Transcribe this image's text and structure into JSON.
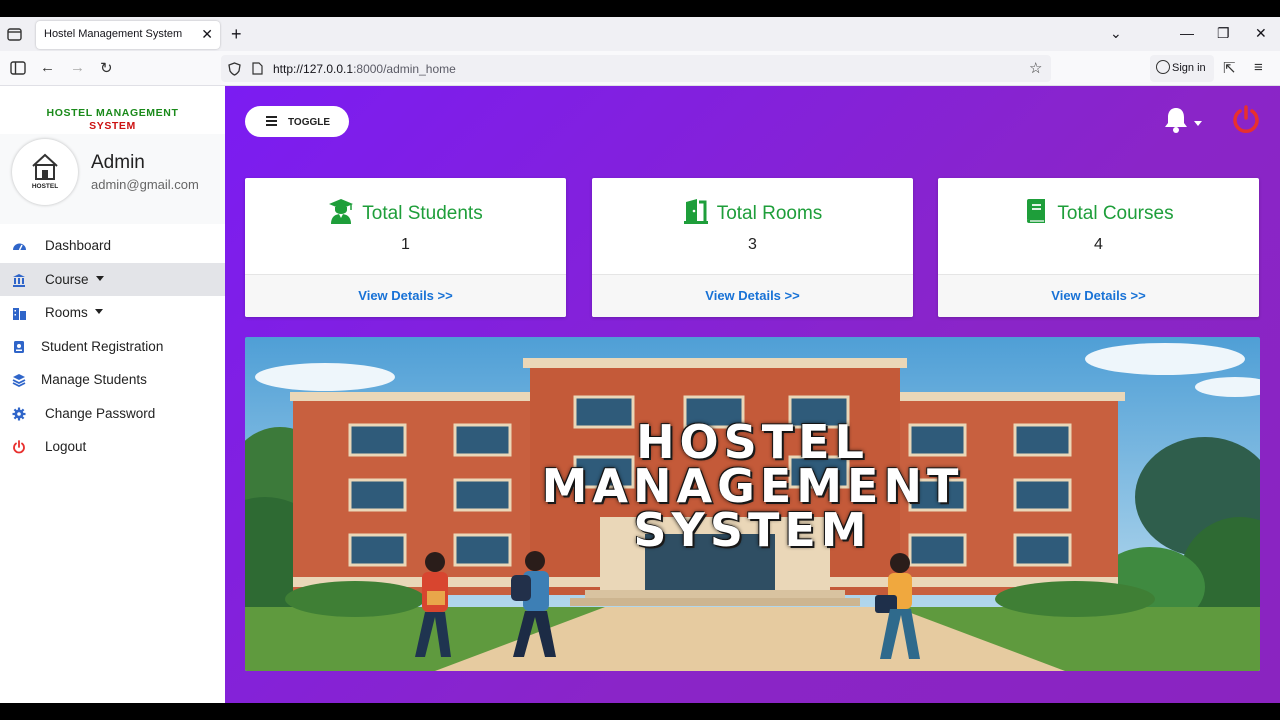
{
  "browser": {
    "tab_title": "Hostel Management System",
    "url_host": "http://127.0.0.1",
    "url_path": ":8000/admin_home",
    "sign_in_label": "Sign in"
  },
  "sidebar": {
    "brand_line1": "HOSTEL MANAGEMENT",
    "brand_line2": "SYSTEM",
    "avatar_text": "HOSTEL",
    "user_name": "Admin",
    "user_email": "admin@gmail.com",
    "items": [
      {
        "label": "Dashboard",
        "icon": "dashboard-icon"
      },
      {
        "label": "Course",
        "icon": "bank-icon",
        "dropdown": true,
        "active": true
      },
      {
        "label": "Rooms",
        "icon": "building-icon",
        "dropdown": true
      },
      {
        "label": "Student Registration",
        "icon": "id-card-icon"
      },
      {
        "label": "Manage Students",
        "icon": "layers-icon"
      },
      {
        "label": "Change Password",
        "icon": "gear-icon"
      },
      {
        "label": "Logout",
        "icon": "power-icon"
      }
    ]
  },
  "header": {
    "toggle_label": "TOGGLE"
  },
  "cards": [
    {
      "title": "Total Students",
      "value": "1",
      "link": "View Details >>",
      "icon": "graduate-icon"
    },
    {
      "title": "Total Rooms",
      "value": "3",
      "link": "View Details >>",
      "icon": "door-icon"
    },
    {
      "title": "Total Courses",
      "value": "4",
      "link": "View Details >>",
      "icon": "book-icon"
    }
  ],
  "banner": {
    "line1": "HOSTEL",
    "line2": "MANAGEMENT",
    "line3": "SYSTEM"
  },
  "colors": {
    "accent_green": "#1e9e3a",
    "link_blue": "#1872d6",
    "power_red": "#e8302e",
    "main_purple": "#7b1cf2"
  }
}
